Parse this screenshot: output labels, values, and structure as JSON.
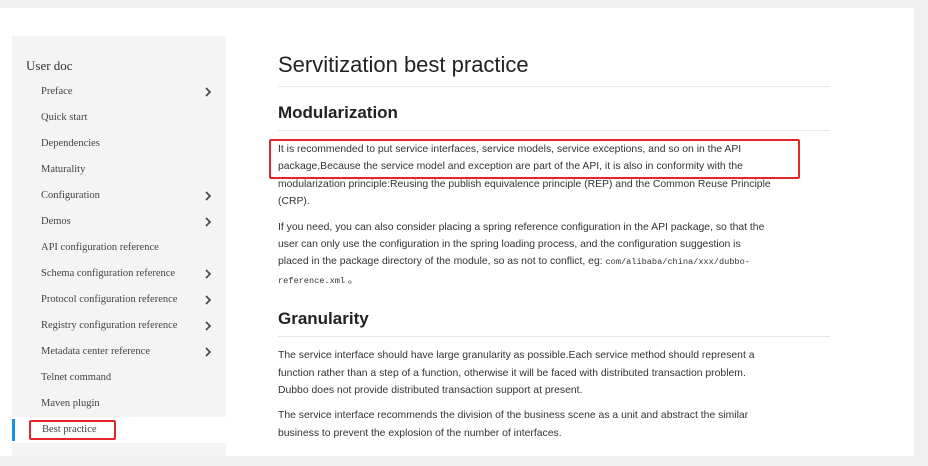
{
  "sidebar": {
    "title": "User doc",
    "items": [
      {
        "label": "Preface",
        "has_children": true
      },
      {
        "label": "Quick start",
        "has_children": false
      },
      {
        "label": "Dependencies",
        "has_children": false
      },
      {
        "label": "Maturality",
        "has_children": false
      },
      {
        "label": "Configuration",
        "has_children": true
      },
      {
        "label": "Demos",
        "has_children": true
      },
      {
        "label": "API configuration reference",
        "has_children": false
      },
      {
        "label": "Schema configuration reference",
        "has_children": true
      },
      {
        "label": "Protocol configuration reference",
        "has_children": true
      },
      {
        "label": "Registry configuration reference",
        "has_children": true
      },
      {
        "label": "Metadata center reference",
        "has_children": true
      },
      {
        "label": "Telnet command",
        "has_children": false
      },
      {
        "label": "Maven plugin",
        "has_children": false
      },
      {
        "label": "Best practice",
        "has_children": false,
        "active": true
      }
    ]
  },
  "content": {
    "title": "Servitization best practice",
    "sections": [
      {
        "heading": "Modularization",
        "paragraphs": {
          "p1_line1": "It is recommended to put service interfaces, service models, service exceptions, and so on in the API",
          "p1_line2": "package,Because the service model and exception are part of the API, it is also in conformity with the",
          "p1_line3": "modularization principle:Reusing the publish equivalence principle (REP) and the Common Reuse Principle",
          "p1_line4": "(CRP).",
          "p2_line1": "If you need, you can also consider placing a spring reference configuration in the API package, so that the",
          "p2_line2": "user can only use the configuration in the spring loading process, and the configuration suggestion is",
          "p2_line3_text": "placed in the package directory of the module, so as not to conflict, eg: ",
          "p2_line3_code": "com/alibaba/china/xxx/dubbo-",
          "p2_line4_code": "reference.xml",
          "p2_line4_tail": " 。"
        }
      },
      {
        "heading": "Granularity",
        "paragraphs": {
          "p1_line1": "The service interface should have large granularity as possible.Each service method should represent a",
          "p1_line2": "function rather than a step of a function, otherwise it will be faced with distributed transaction problem.",
          "p1_line3": "Dubbo does not provide distributed transaction support at present.",
          "p2_line1": "The service interface recommends the division of the business scene as a unit and abstract the similar",
          "p2_line2": "business to prevent the explosion of the number of interfaces."
        }
      }
    ]
  },
  "colors": {
    "highlight": "#e3262b",
    "active_bar": "#1b8ff0",
    "sidebar_bg": "#f4f4f4",
    "outer_bg": "#efefef"
  }
}
